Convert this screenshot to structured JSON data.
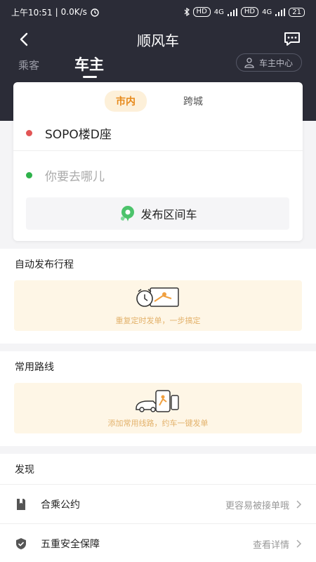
{
  "status": {
    "time": "上午10:51",
    "speed": "0.0K/s",
    "hd1": "HD",
    "hd2": "HD",
    "net1": "4G",
    "net2": "4G",
    "battery": "21"
  },
  "nav": {
    "title": "顺风车"
  },
  "tabs": {
    "passenger": "乘客",
    "driver": "车主",
    "driver_center": "车主中心"
  },
  "trip": {
    "seg_city": "市内",
    "seg_intercity": "跨城",
    "from": "SOPO楼D座",
    "to_placeholder": "你要去哪儿",
    "publish": "发布区间车",
    "from_dot_color": "#e25555",
    "to_dot_color": "#2eb24b"
  },
  "auto": {
    "title": "自动发布行程",
    "caption": "重复定时发单，一步搞定"
  },
  "routes": {
    "title": "常用路线",
    "caption": "添加常用线路，约车一键发单"
  },
  "discover": {
    "title": "发现",
    "items": [
      {
        "label": "合乘公约",
        "hint": "更容易被接单哦",
        "icon": "book-icon"
      },
      {
        "label": "五重安全保障",
        "hint": "查看详情",
        "icon": "shield-icon"
      }
    ]
  },
  "colors": {
    "header_bg": "#2b2c37",
    "accent": "#e7891a",
    "promo_bg": "#fef6e6",
    "publish_icon": "#4cc36b"
  }
}
